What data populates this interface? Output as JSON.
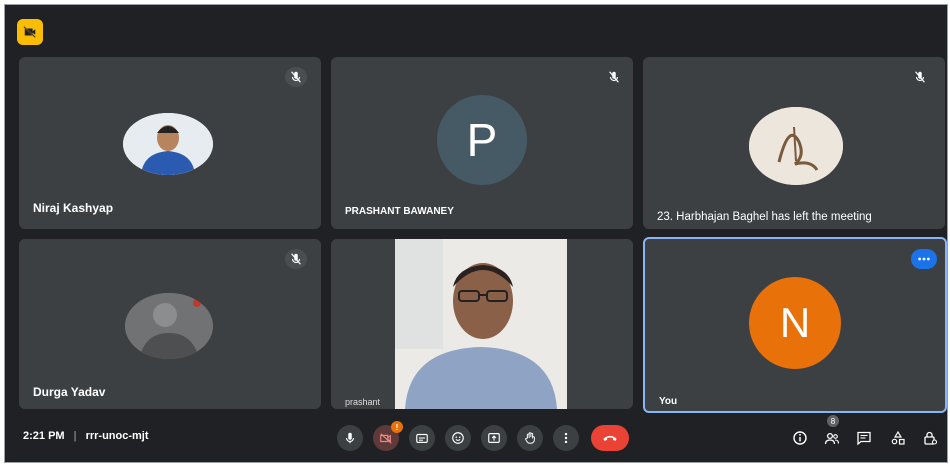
{
  "window": {
    "badge_icon": "camera-off-icon",
    "accent": "#fbbc04"
  },
  "participants": [
    {
      "name": "Niraj Kashyap"
    },
    {
      "name": "PRASHANT BAWANEY",
      "initial": "P",
      "avatar_color": "#455a64"
    },
    {
      "name": "23. Harbhajan Baghel has left the meeting"
    },
    {
      "name": "Durga Yadav"
    },
    {
      "name": "prashant"
    },
    {
      "name": "You",
      "initial": "N",
      "avatar_color": "#e8710a"
    }
  ],
  "bottom_bar": {
    "time": "2:21 PM",
    "separator": "|",
    "meeting_code": "rrr-unoc-mjt",
    "notification_count": "!",
    "people_count": "8"
  },
  "controls": [
    "mic-icon",
    "camera-off-icon",
    "captions-icon",
    "emoji-icon",
    "present-icon",
    "raise-hand-icon",
    "more-options-icon",
    "end-call-icon"
  ],
  "right_controls": [
    "info-icon",
    "people-icon",
    "chat-icon",
    "activities-icon",
    "host-controls-icon"
  ],
  "colors": {
    "end_call": "#ea4335",
    "active_border": "#8ab4f8",
    "more_button": "#1a73e8"
  }
}
